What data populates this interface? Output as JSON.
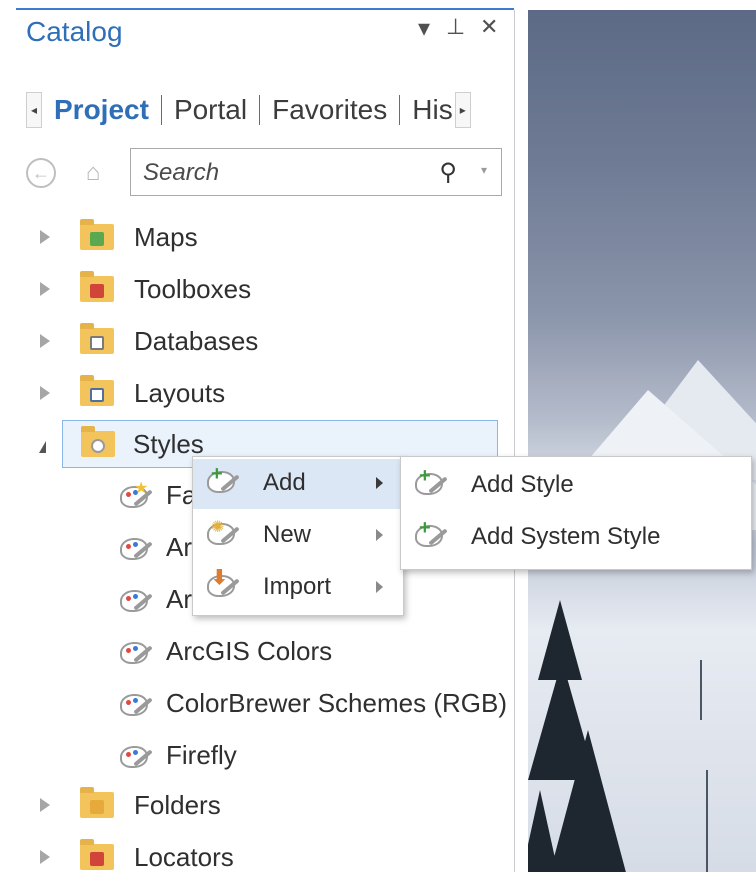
{
  "catalog": {
    "title": "Catalog",
    "tools": {
      "menu_glyph": "▾",
      "pin_glyph": "⊥",
      "close_glyph": "✕"
    }
  },
  "tabs": {
    "left_arrow": "◂",
    "right_arrow": "▸",
    "items": [
      {
        "label": "Project",
        "active": true
      },
      {
        "label": "Portal"
      },
      {
        "label": "Favorites"
      },
      {
        "label": "His"
      }
    ]
  },
  "nav": {
    "back_glyph": "←",
    "home_glyph": "⌂",
    "search_placeholder": "Search",
    "search_glyph": "⚲",
    "dropdown_glyph": "▾"
  },
  "tree": {
    "items": [
      {
        "label": "Maps",
        "icon": "map-folder-icon"
      },
      {
        "label": "Toolboxes",
        "icon": "toolbox-folder-icon"
      },
      {
        "label": "Databases",
        "icon": "database-folder-icon"
      },
      {
        "label": "Layouts",
        "icon": "layout-folder-icon"
      },
      {
        "label": "Styles",
        "icon": "styles-folder-icon",
        "expanded": true,
        "selected": true
      },
      {
        "label": "Folders",
        "icon": "folders-folder-icon"
      },
      {
        "label": "Locators",
        "icon": "locators-folder-icon"
      }
    ],
    "styles": [
      {
        "label": "Fa",
        "icon": "favorites-style-icon"
      },
      {
        "label": "Ar",
        "icon": "style-icon"
      },
      {
        "label": "Ar",
        "icon": "style-icon"
      },
      {
        "label": "ArcGIS Colors",
        "icon": "style-icon"
      },
      {
        "label": "ColorBrewer Schemes (RGB)",
        "icon": "style-icon"
      },
      {
        "label": "Firefly",
        "icon": "style-icon"
      }
    ]
  },
  "context_menu": {
    "items": [
      {
        "label": "Add",
        "highlighted": true
      },
      {
        "label": "New"
      },
      {
        "label": "Import"
      }
    ]
  },
  "submenu": {
    "items": [
      {
        "label": "Add Style"
      },
      {
        "label": "Add System Style"
      }
    ]
  },
  "colors": {
    "accent": "#2e6fb7",
    "selection_bg": "#eaf2fc",
    "menu_highlight": "#dbe7f5",
    "folder": "#f3c45b"
  }
}
